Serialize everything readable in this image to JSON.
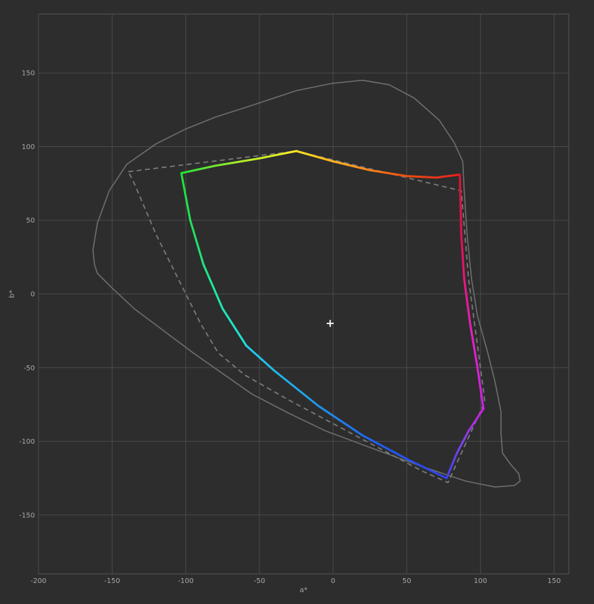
{
  "chart_data": {
    "type": "line",
    "xlabel": "a*",
    "ylabel": "b*",
    "xlim": [
      -200,
      160
    ],
    "ylim": [
      -190,
      190
    ],
    "x_ticks": [
      -200,
      -150,
      -100,
      -50,
      0,
      50,
      100,
      150
    ],
    "y_ticks": [
      -150,
      -100,
      -50,
      0,
      50,
      100,
      150
    ],
    "grid": true,
    "white_point": {
      "a": -2,
      "b": -20
    },
    "colors": {
      "background": "#2d2d2d",
      "grid": "#4a4a4a",
      "frame": "#555555",
      "reference_outline": "#6e6e6e",
      "dashed_gamut": "#7a7a7a",
      "white_point": "#f0f0f0"
    },
    "series": [
      {
        "style": "solid-outline",
        "points": [
          [
            20,
            145
          ],
          [
            0,
            143
          ],
          [
            -25,
            138
          ],
          [
            -55,
            128
          ],
          [
            -80,
            120
          ],
          [
            -100,
            112
          ],
          [
            -120,
            102
          ],
          [
            -140,
            88
          ],
          [
            -152,
            70
          ],
          [
            -160,
            48
          ],
          [
            -163,
            30
          ],
          [
            -162,
            20
          ],
          [
            -160,
            14
          ],
          [
            -150,
            4
          ],
          [
            -135,
            -10
          ],
          [
            -115,
            -25
          ],
          [
            -95,
            -40
          ],
          [
            -75,
            -54
          ],
          [
            -55,
            -68
          ],
          [
            -30,
            -81
          ],
          [
            -5,
            -93
          ],
          [
            30,
            -106
          ],
          [
            60,
            -117
          ],
          [
            90,
            -127
          ],
          [
            110,
            -131
          ],
          [
            123,
            -130
          ],
          [
            127,
            -127
          ],
          [
            126,
            -122
          ],
          [
            120,
            -115
          ],
          [
            115,
            -108
          ],
          [
            114,
            -95
          ],
          [
            114,
            -80
          ],
          [
            110,
            -60
          ],
          [
            105,
            -40
          ],
          [
            98,
            -15
          ],
          [
            94,
            10
          ],
          [
            91,
            40
          ],
          [
            89,
            70
          ],
          [
            88,
            90
          ],
          [
            82,
            103
          ],
          [
            72,
            118
          ],
          [
            55,
            133
          ],
          [
            38,
            142
          ],
          [
            20,
            145
          ]
        ]
      },
      {
        "style": "dashed-gamut",
        "points": [
          [
            -139,
            83
          ],
          [
            -25,
            97
          ],
          [
            87,
            70
          ],
          [
            92,
            10
          ],
          [
            100,
            -50
          ],
          [
            103,
            -73
          ],
          [
            78,
            -128
          ],
          [
            60,
            -120
          ],
          [
            30,
            -104
          ],
          [
            0,
            -88
          ],
          [
            -30,
            -72
          ],
          [
            -60,
            -55
          ],
          [
            -78,
            -40
          ],
          [
            -90,
            -20
          ],
          [
            -105,
            10
          ],
          [
            -120,
            40
          ],
          [
            -135,
            75
          ],
          [
            -139,
            83
          ]
        ]
      },
      {
        "style": "spectral-gamut",
        "segments": [
          {
            "points": [
              [
                -103,
                82
              ],
              [
                -80,
                87
              ],
              [
                -50,
                92
              ],
              [
                -25,
                97
              ]
            ],
            "colors": [
              "#22e038",
              "#aaf02a",
              "#ffee20"
            ]
          },
          {
            "points": [
              [
                -25,
                97
              ],
              [
                0,
                90
              ],
              [
                25,
                84
              ],
              [
                50,
                80
              ],
              [
                70,
                79
              ],
              [
                86,
                81
              ]
            ],
            "colors": [
              "#ffe020",
              "#ffa020",
              "#f05010",
              "#e82020"
            ]
          },
          {
            "points": [
              [
                86,
                81
              ],
              [
                87,
                40
              ],
              [
                89,
                10
              ],
              [
                93,
                -20
              ],
              [
                98,
                -50
              ],
              [
                102,
                -78
              ]
            ],
            "colors": [
              "#e01030",
              "#e81060",
              "#e820c0",
              "#d020f0"
            ]
          },
          {
            "points": [
              [
                102,
                -78
              ],
              [
                92,
                -93
              ],
              [
                84,
                -108
              ],
              [
                77,
                -125
              ]
            ],
            "colors": [
              "#d020e0",
              "#8040f0",
              "#4040f0"
            ]
          },
          {
            "points": [
              [
                77,
                -125
              ],
              [
                50,
                -112
              ],
              [
                20,
                -96
              ],
              [
                -10,
                -76
              ],
              [
                -40,
                -52
              ],
              [
                -59,
                -35
              ]
            ],
            "colors": [
              "#3040f0",
              "#2060f0",
              "#20a0e8",
              "#20d0e8"
            ]
          },
          {
            "points": [
              [
                -59,
                -35
              ],
              [
                -75,
                -10
              ],
              [
                -88,
                20
              ],
              [
                -97,
                50
              ],
              [
                -103,
                82
              ]
            ],
            "colors": [
              "#20e0e0",
              "#20e8a0",
              "#20e060",
              "#22e038"
            ]
          }
        ]
      }
    ]
  }
}
